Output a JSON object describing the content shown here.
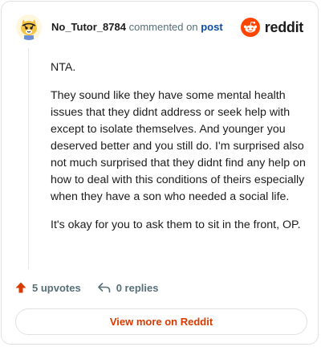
{
  "header": {
    "username": "No_Tutor_8784",
    "commented_text": "commented on",
    "post_link": "post",
    "brand_name": "reddit"
  },
  "comment": {
    "paragraphs": [
      "NTA.",
      "They sound like they have some mental health issues that they didnt address or seek help with except to isolate themselves. And younger you deserved better and you still do. I'm surprised also not much surprised that they didnt find any help on how to deal with this conditions of theirs especially when they have a son who needed a social life.",
      "It's okay for you to ask them to sit in the front, OP."
    ]
  },
  "actions": {
    "upvotes": "5 upvotes",
    "replies": "0 replies"
  },
  "footer": {
    "view_more": "View more on Reddit"
  },
  "colors": {
    "brand": "#ff4500",
    "link": "#0a4da6",
    "view_more": "#d93a00"
  },
  "icons": {
    "avatar": "cartoon-avatar-icon",
    "brand": "reddit-snoo-icon",
    "upvote": "upvote-arrow-icon",
    "reply": "reply-arrow-icon"
  }
}
